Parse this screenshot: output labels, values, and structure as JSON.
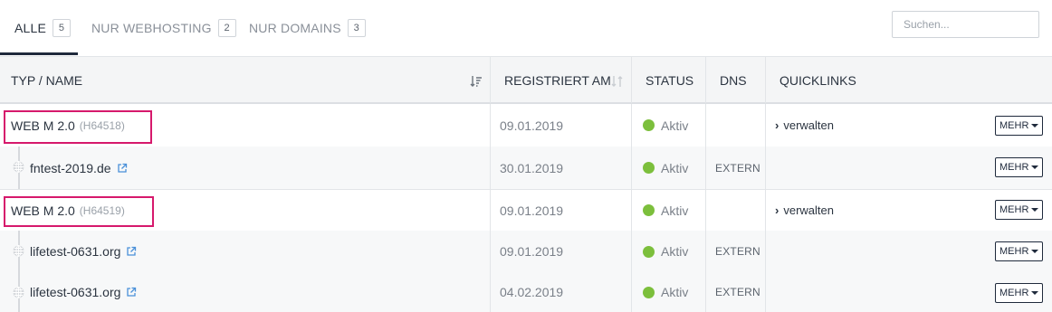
{
  "tabs": [
    {
      "label": "ALLE",
      "count": "5"
    },
    {
      "label": "NUR WEBHOSTING",
      "count": "2"
    },
    {
      "label": "NUR DOMAINS",
      "count": "3"
    }
  ],
  "search": {
    "placeholder": "Suchen..."
  },
  "table": {
    "headers": {
      "name": "TYP / NAME",
      "registered": "REGISTRIERT AM",
      "status": "STATUS",
      "dns": "DNS",
      "quicklinks": "QUICKLINKS"
    },
    "rows": [
      {
        "type": "webhosting",
        "name": "WEB M 2.0",
        "code": "(H64518)",
        "date": "09.01.2019",
        "status": "Aktiv",
        "dns": "",
        "quicklink": "verwalten",
        "more": "MEHR"
      },
      {
        "type": "domain",
        "name": "fntest-2019.de",
        "date": "30.01.2019",
        "status": "Aktiv",
        "dns": "EXTERN",
        "quicklink": "",
        "more": "MEHR"
      },
      {
        "type": "webhosting",
        "name": "WEB M 2.0",
        "code": "(H64519)",
        "date": "09.01.2019",
        "status": "Aktiv",
        "dns": "",
        "quicklink": "verwalten",
        "more": "MEHR"
      },
      {
        "type": "domain",
        "name": "lifetest-0631.org",
        "date": "09.01.2019",
        "status": "Aktiv",
        "dns": "EXTERN",
        "quicklink": "",
        "more": "MEHR"
      },
      {
        "type": "domain",
        "name": "lifetest-0631.org",
        "date": "04.02.2019",
        "status": "Aktiv",
        "dns": "EXTERN",
        "quicklink": "",
        "more": "MEHR"
      }
    ]
  },
  "colors": {
    "accent": "#1f2a3c",
    "highlight": "#d6196c",
    "status_active": "#7cbf3c"
  },
  "icons": [
    "sort-icon",
    "globe-icon",
    "external-link-icon",
    "chevron-right-icon",
    "caret-down-icon"
  ]
}
